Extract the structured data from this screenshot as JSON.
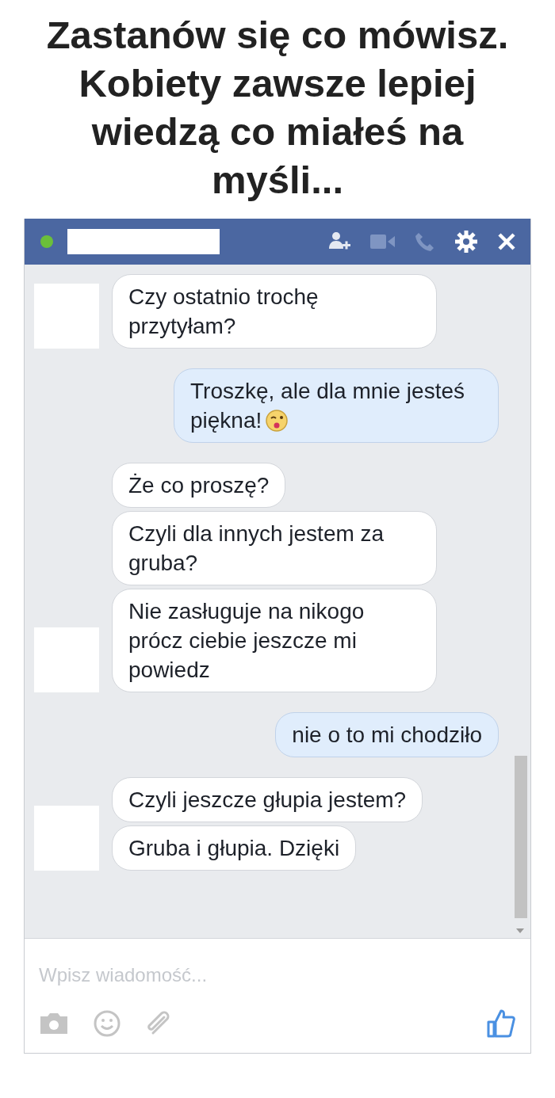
{
  "title": "Zastanów się co mówisz. Kobiety zawsze lepiej wiedzą co miałeś na myśli...",
  "chat": {
    "online": true,
    "groups": [
      {
        "outgoing": false,
        "bubbles": [
          {
            "text": "Czy ostatnio trochę przytyłam?",
            "emoji": false
          }
        ]
      },
      {
        "outgoing": true,
        "bubbles": [
          {
            "text": "Troszkę, ale dla mnie jesteś piękna!",
            "emoji": true
          }
        ]
      },
      {
        "outgoing": false,
        "bubbles": [
          {
            "text": "Że co proszę?",
            "emoji": false
          },
          {
            "text": "Czyli dla innych jestem za gruba?",
            "emoji": false
          },
          {
            "text": "Nie zasługuje na nikogo prócz ciebie jeszcze mi powiedz",
            "emoji": false
          }
        ]
      },
      {
        "outgoing": true,
        "bubbles": [
          {
            "text": "nie o to mi chodziło",
            "emoji": false
          }
        ]
      },
      {
        "outgoing": false,
        "bubbles": [
          {
            "text": "Czyli jeszcze głupia jestem?",
            "emoji": false
          },
          {
            "text": "Gruba i głupia. Dzięki",
            "emoji": false
          }
        ]
      }
    ],
    "input": {
      "placeholder": "Wpisz wiadomość..."
    }
  }
}
